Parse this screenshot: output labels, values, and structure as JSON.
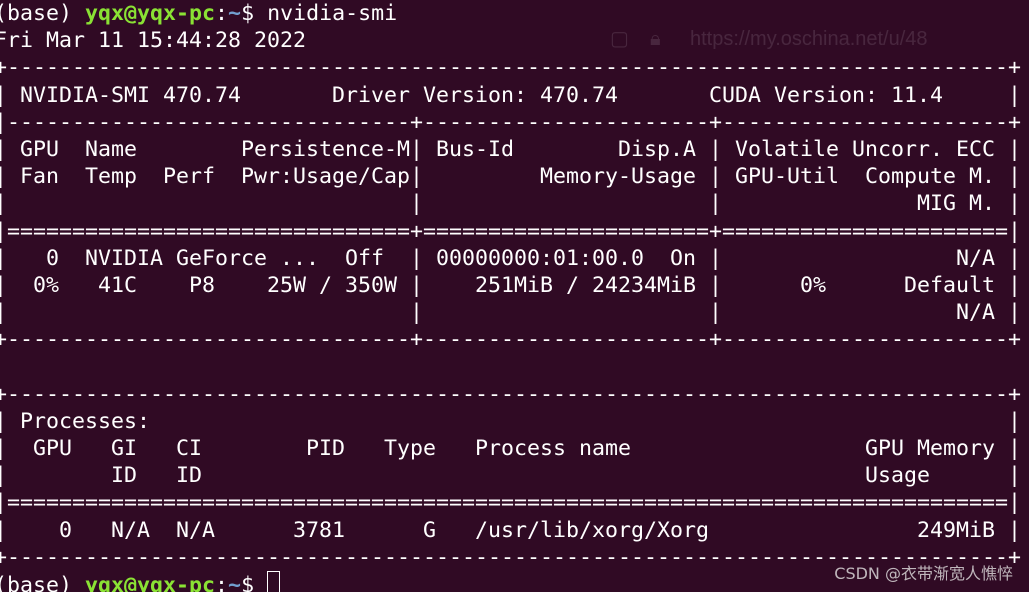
{
  "prompt": {
    "env": "(base) ",
    "user_host": "yqx@yqx-pc",
    "colon": ":",
    "path": "~",
    "dollar": "$ ",
    "command": "nvidia-smi"
  },
  "timestamp": "Fri Mar 11 15:44:28 2022",
  "smi_lines": [
    "+-----------------------------------------------------------------------------+",
    "| NVIDIA-SMI 470.74       Driver Version: 470.74       CUDA Version: 11.4     |",
    "|-------------------------------+----------------------+----------------------+",
    "| GPU  Name        Persistence-M| Bus-Id        Disp.A | Volatile Uncorr. ECC |",
    "| Fan  Temp  Perf  Pwr:Usage/Cap|         Memory-Usage | GPU-Util  Compute M. |",
    "|                               |                      |               MIG M. |",
    "|===============================+======================+======================|",
    "|   0  NVIDIA GeForce ...  Off  | 00000000:01:00.0  On |                  N/A |",
    "|  0%   41C    P8    25W / 350W |    251MiB / 24234MiB |      0%      Default |",
    "|                               |                      |                  N/A |",
    "+-------------------------------+----------------------+----------------------+",
    "",
    "+-----------------------------------------------------------------------------+",
    "| Processes:                                                                  |",
    "|  GPU   GI   CI        PID   Type   Process name                  GPU Memory |",
    "|        ID   ID                                                   Usage      |",
    "|=============================================================================|",
    "|    0   N/A  N/A      3781      G   /usr/lib/xorg/Xorg                249MiB |",
    "+-----------------------------------------------------------------------------+"
  ],
  "ghost_url": "https://my.oschina.net/u/48",
  "watermark": "CSDN @衣带渐宽人憔悴"
}
